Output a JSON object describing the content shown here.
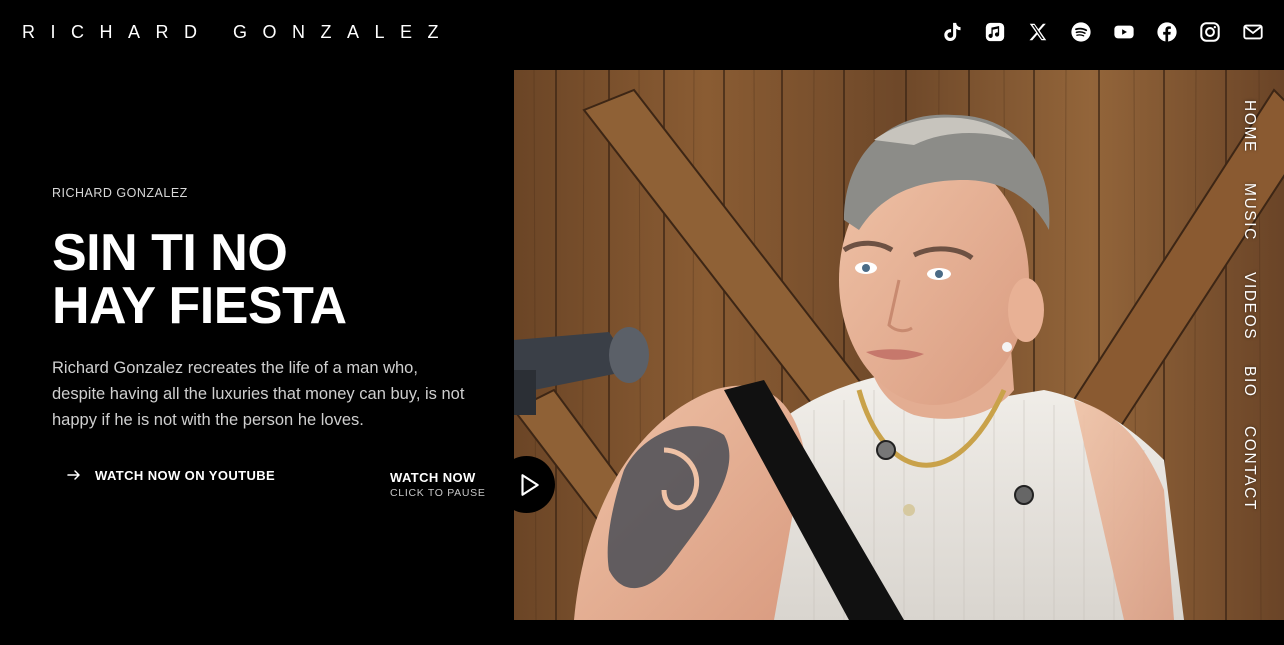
{
  "header": {
    "site_name": "RICHARD GONZALEZ",
    "social": [
      {
        "name": "tiktok-icon"
      },
      {
        "name": "apple-music-icon"
      },
      {
        "name": "x-twitter-icon"
      },
      {
        "name": "spotify-icon"
      },
      {
        "name": "youtube-icon"
      },
      {
        "name": "facebook-icon"
      },
      {
        "name": "instagram-icon"
      },
      {
        "name": "mail-icon"
      }
    ]
  },
  "hero": {
    "eyebrow": "RICHARD GONZALEZ",
    "title_line1": "SIN TI NO",
    "title_line2": "HAY FIESTA",
    "description": "Richard Gonzalez recreates the life of a man who, despite having all the luxuries that money can buy, is not happy if he is not with the person he loves.",
    "cta_label": "WATCH NOW ON YOUTUBE"
  },
  "video": {
    "watch_title": "WATCH NOW",
    "watch_sub": "CLICK TO PAUSE"
  },
  "side_nav": {
    "home": "HOME",
    "music": "MUSIC",
    "videos": "VIDEOS",
    "bio": "BIO",
    "contact": "CONTACT"
  },
  "colors": {
    "background": "#000000",
    "text": "#ffffff",
    "muted_text": "#cfcfcf"
  }
}
